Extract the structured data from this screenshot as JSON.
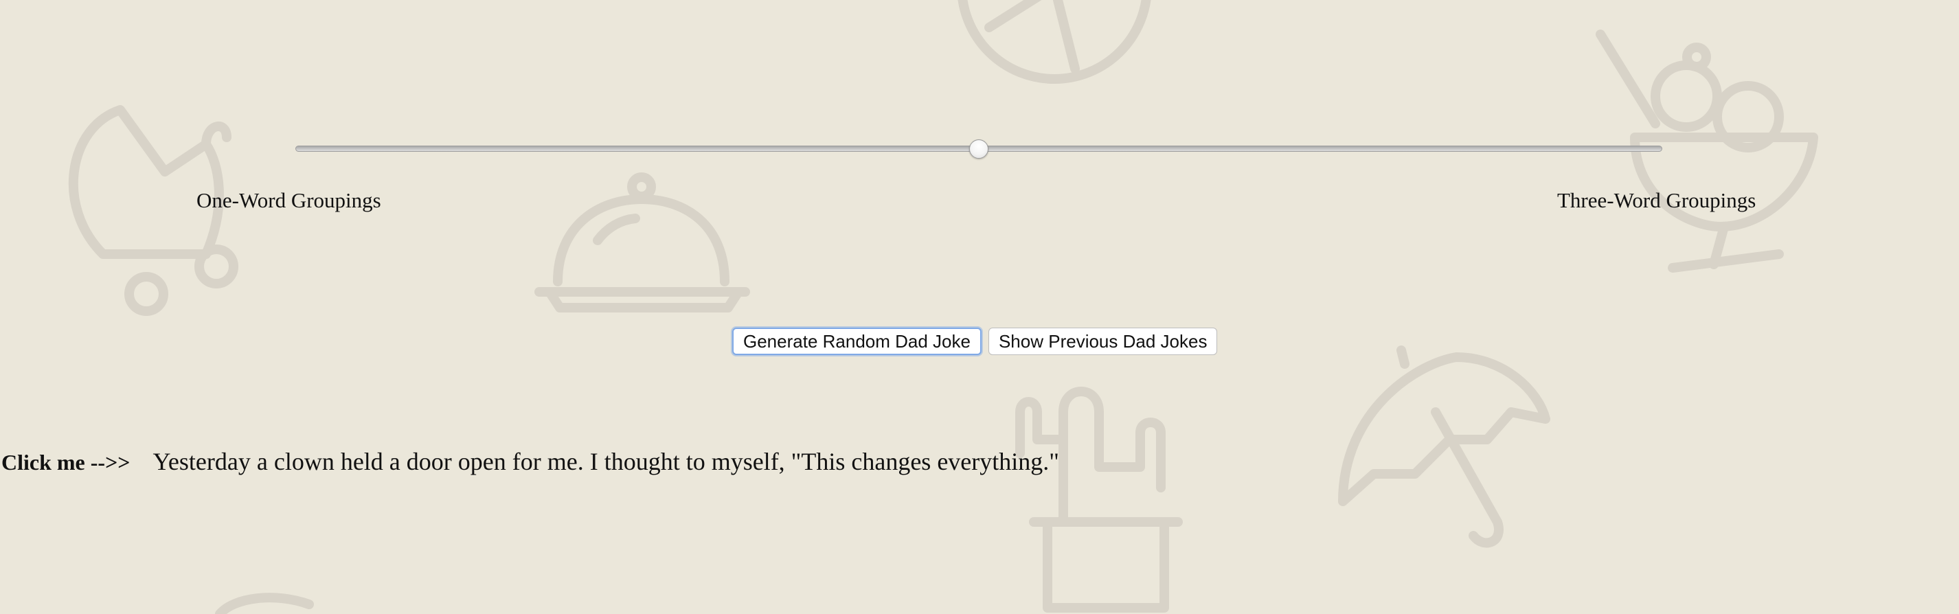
{
  "background": {
    "color": "#ebe7da",
    "doodles": [
      "baby-carriage-icon",
      "cloche-icon",
      "pizza-icon",
      "cactus-icon",
      "umbrella-icon",
      "ice-cream-sundae-icon"
    ]
  },
  "slider": {
    "value_fraction": 0.5,
    "min_label": "One-Word Groupings",
    "max_label": "Three-Word Groupings"
  },
  "buttons": {
    "generate_label": "Generate Random Dad Joke",
    "previous_label": "Show Previous Dad Jokes",
    "focus_color": "#7fa9e6"
  },
  "joke": {
    "click_label": "Click me -->>",
    "text": "Yesterday a clown held a door open for me. I thought to myself, \"This changes everything.\""
  }
}
